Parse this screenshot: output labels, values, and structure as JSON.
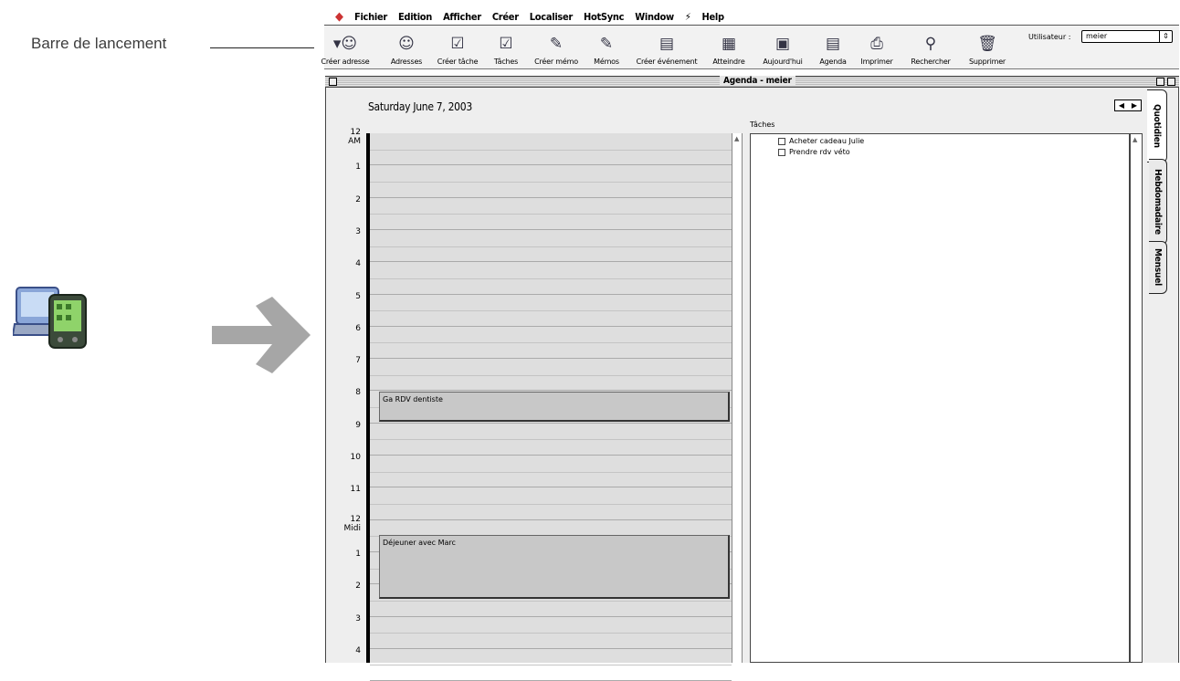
{
  "callout": {
    "label": "Barre de lancement"
  },
  "menubar": {
    "items": [
      "Fichier",
      "Edition",
      "Afficher",
      "Créer",
      "Localiser",
      "HotSync",
      "Window",
      "Help"
    ]
  },
  "toolbar": {
    "buttons": [
      {
        "label": "Créer adresse",
        "icon": "add-person-icon"
      },
      {
        "label": "Adresses",
        "icon": "address-book-icon"
      },
      {
        "label": "Créer tâche",
        "icon": "new-task-icon"
      },
      {
        "label": "Tâches",
        "icon": "tasks-icon"
      },
      {
        "label": "Créer mémo",
        "icon": "new-memo-icon"
      },
      {
        "label": "Mémos",
        "icon": "memo-icon"
      },
      {
        "label": "Créer événement",
        "icon": "new-event-icon"
      },
      {
        "label": "Atteindre",
        "icon": "goto-icon"
      },
      {
        "label": "Aujourd'hui",
        "icon": "today-icon"
      },
      {
        "label": "Agenda",
        "icon": "agenda-icon"
      },
      {
        "label": "Imprimer",
        "icon": "printer-icon"
      },
      {
        "label": "Rechercher",
        "icon": "search-icon"
      },
      {
        "label": "Supprimer",
        "icon": "trash-icon"
      }
    ],
    "user_label": "Utilisateur :",
    "user_value": "meier"
  },
  "window": {
    "title": "Agenda - meier"
  },
  "agenda": {
    "date": "Saturday June 7, 2003",
    "hours": [
      {
        "h": "12",
        "sub": "AM"
      },
      {
        "h": "1"
      },
      {
        "h": "2"
      },
      {
        "h": "3"
      },
      {
        "h": "4"
      },
      {
        "h": "5"
      },
      {
        "h": "6"
      },
      {
        "h": "7"
      },
      {
        "h": "8"
      },
      {
        "h": "9"
      },
      {
        "h": "10"
      },
      {
        "h": "11"
      },
      {
        "h": "12",
        "sub": "Midi"
      },
      {
        "h": "1"
      },
      {
        "h": "2"
      },
      {
        "h": "3"
      },
      {
        "h": "4"
      }
    ],
    "events": [
      {
        "label": "Ga RDV dentiste"
      },
      {
        "label": "Déjeuner avec Marc"
      }
    ]
  },
  "tasks": {
    "label": "Tâches",
    "items": [
      "Acheter cadeau Julie",
      "Prendre rdv véto"
    ]
  },
  "tabs": [
    "Quotidien",
    "Hebdomadaire",
    "Mensuel"
  ]
}
